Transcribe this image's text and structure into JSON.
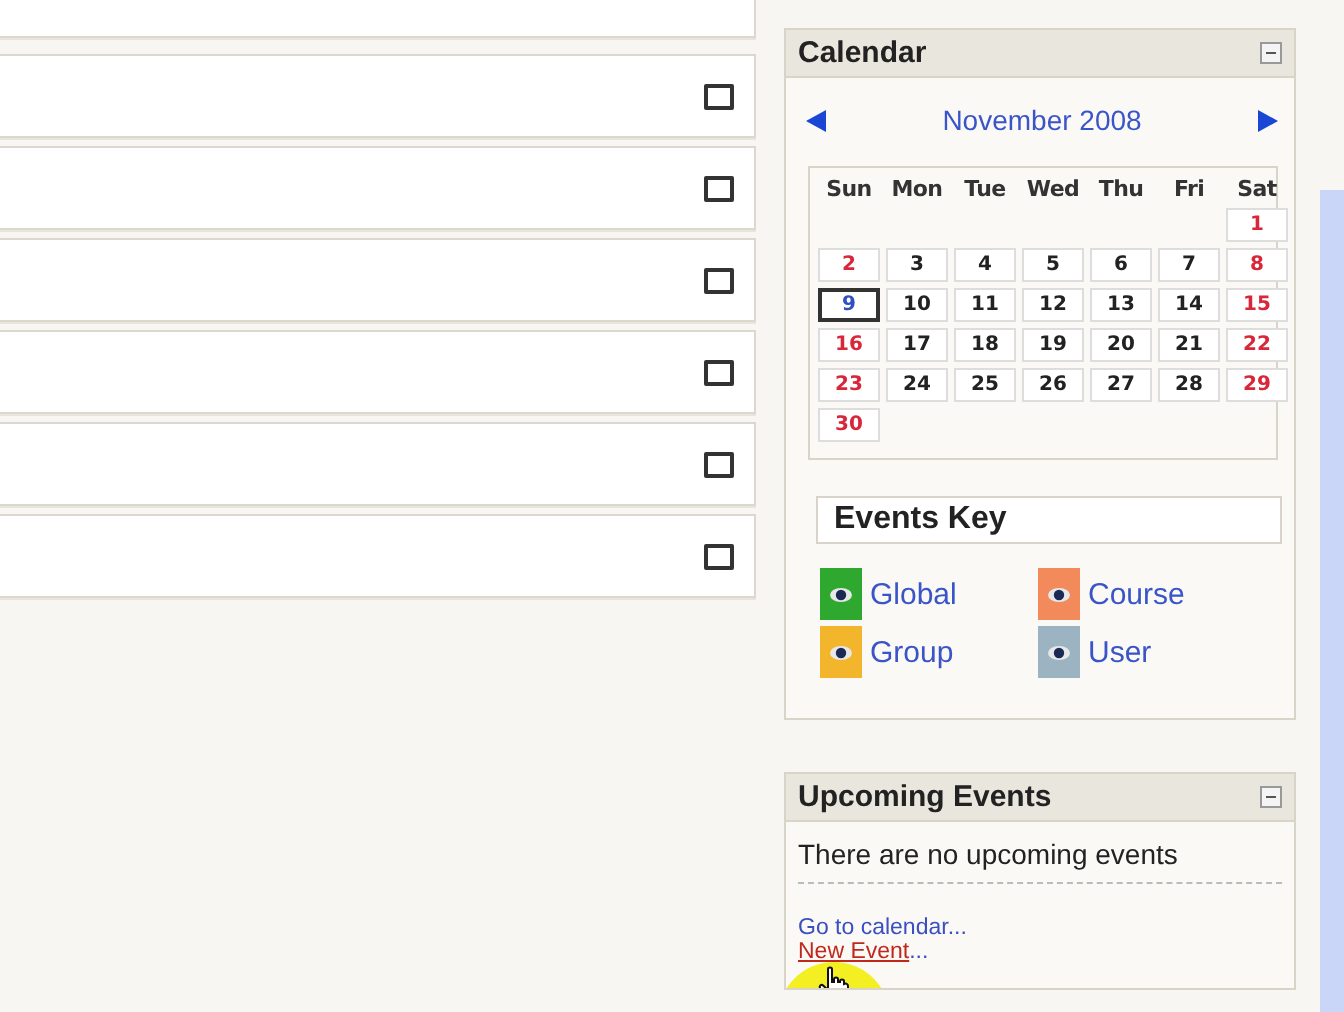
{
  "list_rows": [
    {
      "checked": false
    },
    {
      "checked": false
    },
    {
      "checked": false
    },
    {
      "checked": false
    },
    {
      "checked": false
    },
    {
      "checked": false
    }
  ],
  "calendar": {
    "title": "Calendar",
    "month": "November 2008",
    "weekdays": [
      "Sun",
      "Mon",
      "Tue",
      "Wed",
      "Thu",
      "Fri",
      "Sat"
    ],
    "weeks": [
      [
        {
          "day": "1",
          "weekend": true,
          "today": false
        }
      ],
      [
        {
          "day": "2",
          "weekend": true,
          "today": false
        },
        {
          "day": "3",
          "weekend": false,
          "today": false
        },
        {
          "day": "4",
          "weekend": false,
          "today": false
        },
        {
          "day": "5",
          "weekend": false,
          "today": false
        },
        {
          "day": "6",
          "weekend": false,
          "today": false
        },
        {
          "day": "7",
          "weekend": false,
          "today": false
        },
        {
          "day": "8",
          "weekend": true,
          "today": false
        }
      ],
      [
        {
          "day": "9",
          "weekend": true,
          "today": true
        },
        {
          "day": "10",
          "weekend": false,
          "today": false
        },
        {
          "day": "11",
          "weekend": false,
          "today": false
        },
        {
          "day": "12",
          "weekend": false,
          "today": false
        },
        {
          "day": "13",
          "weekend": false,
          "today": false
        },
        {
          "day": "14",
          "weekend": false,
          "today": false
        },
        {
          "day": "15",
          "weekend": true,
          "today": false
        }
      ],
      [
        {
          "day": "16",
          "weekend": true,
          "today": false
        },
        {
          "day": "17",
          "weekend": false,
          "today": false
        },
        {
          "day": "18",
          "weekend": false,
          "today": false
        },
        {
          "day": "19",
          "weekend": false,
          "today": false
        },
        {
          "day": "20",
          "weekend": false,
          "today": false
        },
        {
          "day": "21",
          "weekend": false,
          "today": false
        },
        {
          "day": "22",
          "weekend": true,
          "today": false
        }
      ],
      [
        {
          "day": "23",
          "weekend": true,
          "today": false
        },
        {
          "day": "24",
          "weekend": false,
          "today": false
        },
        {
          "day": "25",
          "weekend": false,
          "today": false
        },
        {
          "day": "26",
          "weekend": false,
          "today": false
        },
        {
          "day": "27",
          "weekend": false,
          "today": false
        },
        {
          "day": "28",
          "weekend": false,
          "today": false
        },
        {
          "day": "29",
          "weekend": true,
          "today": false
        }
      ],
      [
        {
          "day": "30",
          "weekend": true,
          "today": false
        }
      ]
    ],
    "events_key": {
      "title": "Events Key",
      "items": [
        {
          "label": "Global",
          "color": "#2ea82e"
        },
        {
          "label": "Course",
          "color": "#f28a5c"
        },
        {
          "label": "Group",
          "color": "#f3b52c"
        },
        {
          "label": "User",
          "color": "#9cb4c2"
        }
      ]
    }
  },
  "upcoming": {
    "title": "Upcoming Events",
    "message": "There are no upcoming events",
    "links": [
      {
        "label": "Go to calendar",
        "suffix": "...",
        "hovered": false
      },
      {
        "label": "New Event",
        "suffix": "...",
        "hovered": true
      }
    ]
  }
}
